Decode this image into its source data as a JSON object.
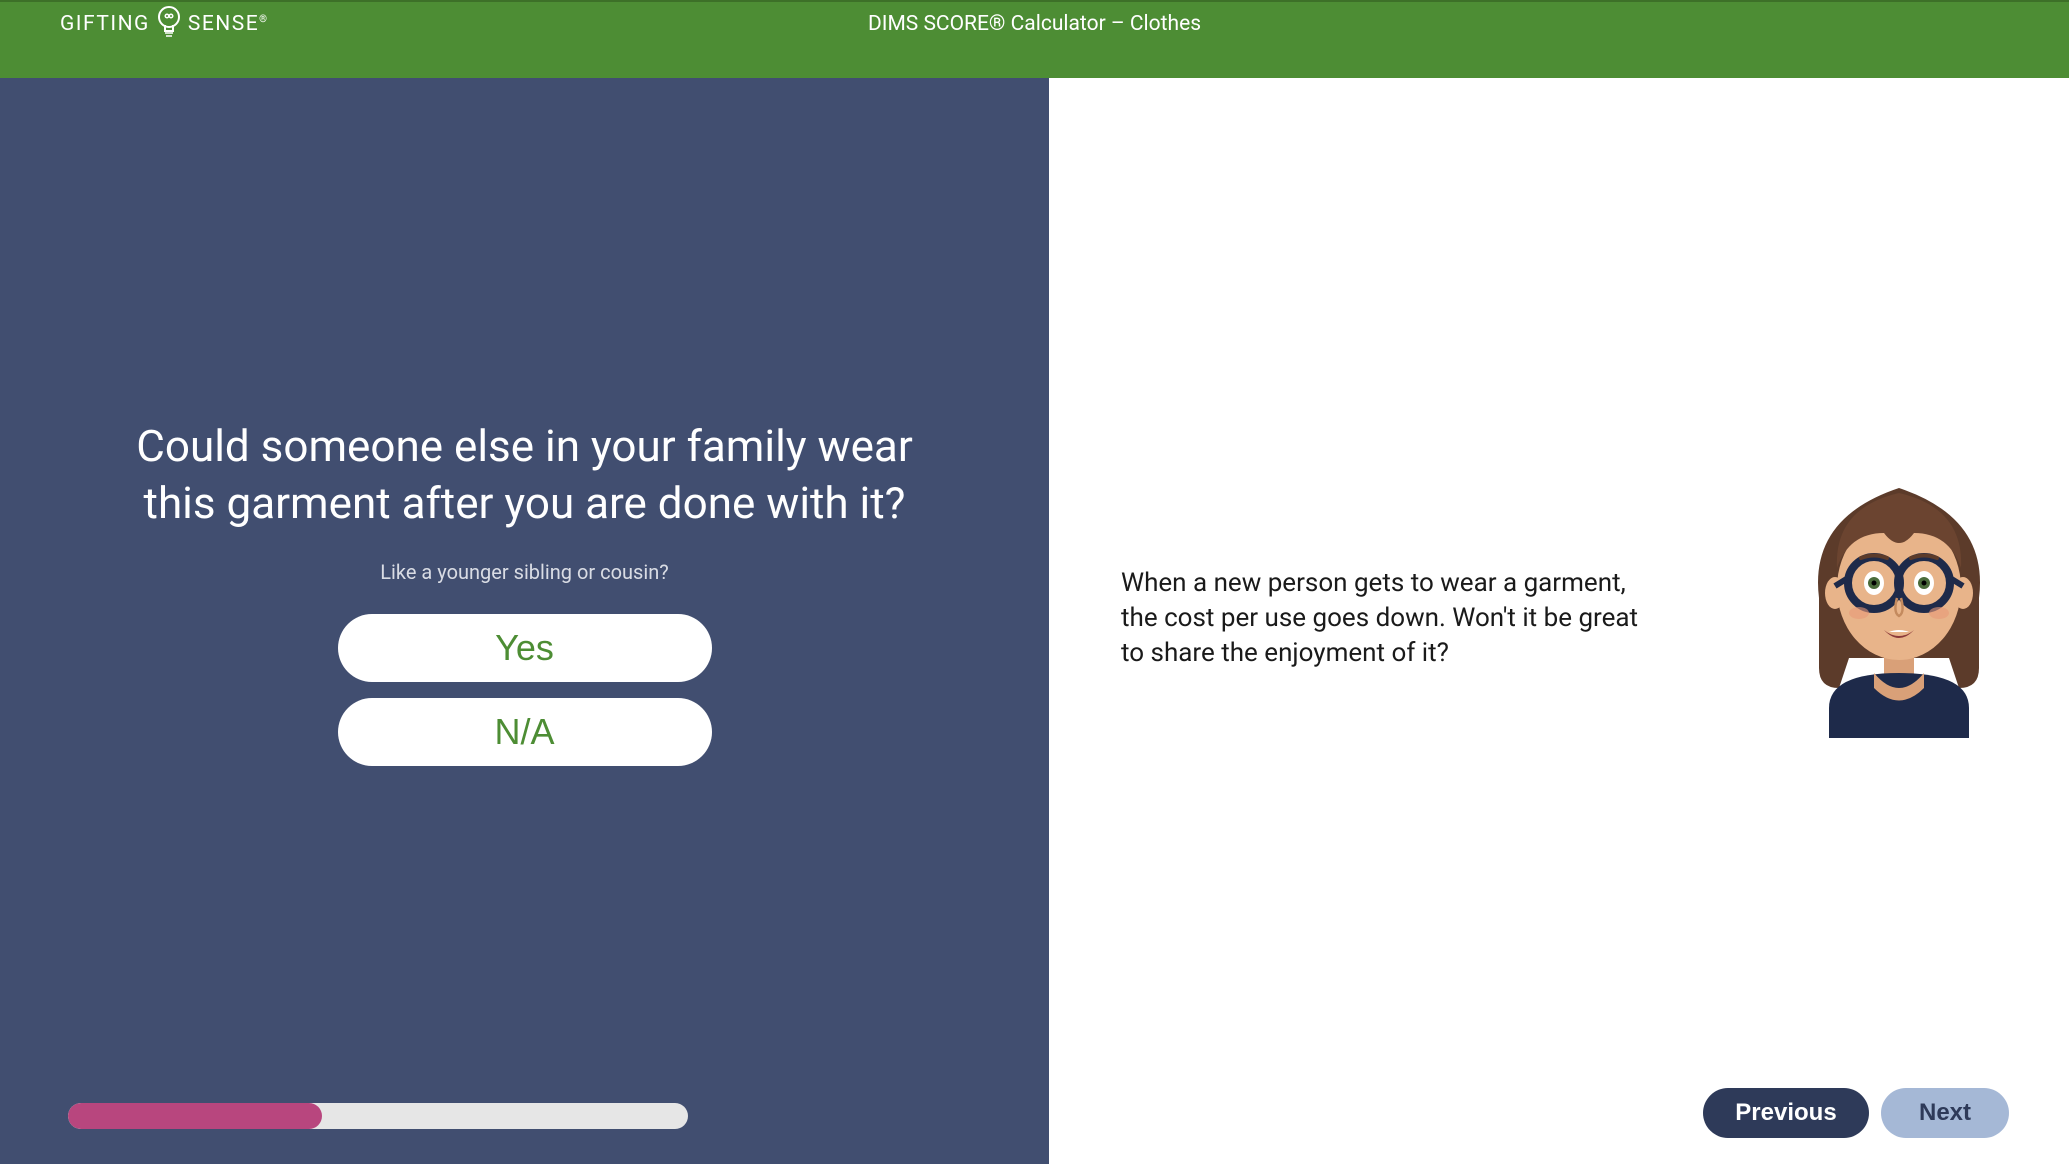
{
  "header": {
    "logo_left": "GIFTING",
    "logo_right": "SENSE",
    "title": "DIMS SCORE® Calculator – Clothes"
  },
  "left": {
    "question": "Could someone else in your family wear this garment after you are done with it?",
    "subtext": "Like a younger sibling or cousin?",
    "options": [
      "Yes",
      "N/A"
    ],
    "progress_percent": 41
  },
  "right": {
    "tip": "When a new person gets to wear a garment, the cost per use goes down. Won't it be great to share the enjoyment of it?"
  },
  "nav": {
    "previous": "Previous",
    "next": "Next"
  },
  "colors": {
    "header_bg": "#4d8d34",
    "left_bg": "#414e70",
    "option_text": "#4d8d34",
    "progress_fill": "#b8467e",
    "prev_bg": "#2e3a59",
    "next_bg": "#a5b8d6"
  }
}
